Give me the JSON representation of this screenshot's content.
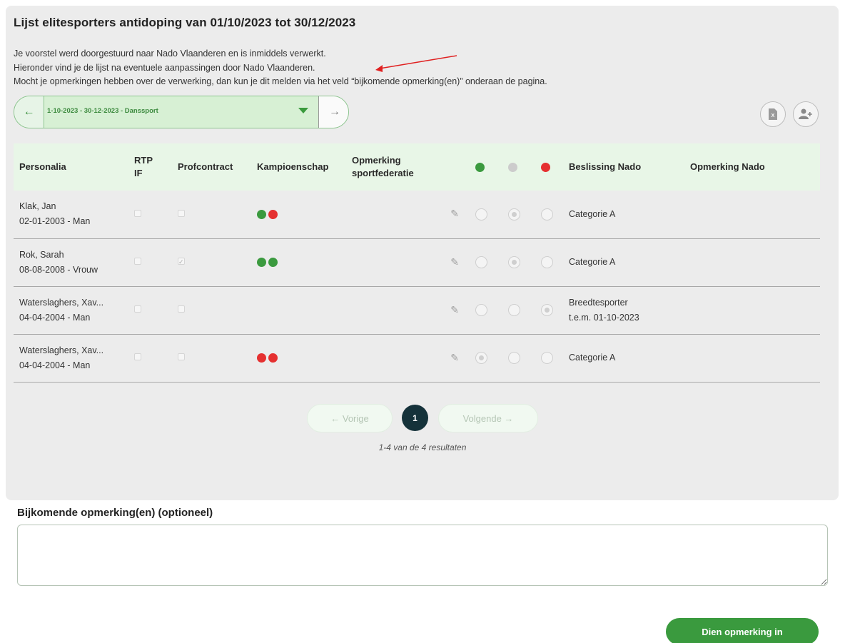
{
  "page": {
    "title": "Lijst elitesporters antidoping van 01/10/2023 tot 30/12/2023",
    "intro_lines": [
      "Je voorstel werd doorgestuurd naar Nado Vlaanderen en is inmiddels verwerkt.",
      "Hieronder vind je de lijst na eventuele aanpassingen door Nado Vlaanderen.",
      "Mocht je opmerkingen hebben over de verwerking, dan kun je dit melden via het veld “bijkomende opmerking(en)” onderaan de pagina."
    ]
  },
  "selector": {
    "value": "1-10-2023 - 30-12-2023 - Danssport",
    "prev_icon": "arrow-left-icon",
    "next_icon": "arrow-right-icon"
  },
  "toolbar": {
    "export_icon": "excel-export-icon",
    "add_user_icon": "add-user-icon"
  },
  "table": {
    "headers": {
      "personalia": "Personalia",
      "rtp_line1": "RTP",
      "rtp_line2": "IF",
      "profcontract": "Profcontract",
      "kampioenschap": "Kampioenschap",
      "opmerking_line1": "Opmerking",
      "opmerking_line2": "sportfederatie",
      "beslissing": "Beslissing Nado",
      "opmerking_nado": "Opmerking Nado"
    },
    "status_colors": {
      "green": "#3b9a3f",
      "grey": "#cccccc",
      "red": "#e53030"
    },
    "rows": [
      {
        "name": "Klak, Jan",
        "details": "02-01-2003 - Man",
        "rtp": false,
        "prof": false,
        "kampioenschap": [
          "green",
          "red"
        ],
        "selected_status": "grey",
        "beslissing": [
          "Categorie A"
        ],
        "opmerking_nado": ""
      },
      {
        "name": "Rok, Sarah",
        "details": "08-08-2008 - Vrouw",
        "rtp": false,
        "prof": true,
        "kampioenschap": [
          "green",
          "green"
        ],
        "selected_status": "grey",
        "beslissing": [
          "Categorie A"
        ],
        "opmerking_nado": ""
      },
      {
        "name": "Waterslaghers, Xav...",
        "details": "04-04-2004 - Man",
        "rtp": false,
        "prof": false,
        "kampioenschap": [],
        "selected_status": "red",
        "beslissing": [
          "Breedtesporter",
          "t.e.m. 01-10-2023"
        ],
        "opmerking_nado": ""
      },
      {
        "name": "Waterslaghers, Xav...",
        "details": "04-04-2004 - Man",
        "rtp": false,
        "prof": false,
        "kampioenschap": [
          "red",
          "red"
        ],
        "selected_status": "green",
        "beslissing": [
          "Categorie A"
        ],
        "opmerking_nado": ""
      }
    ]
  },
  "pagination": {
    "prev_label": "← Vorige",
    "current_page": "1",
    "next_label": "Volgende →",
    "results_text": "1-4 van de 4 resultaten"
  },
  "remarks": {
    "label": "Bijkomende opmerking(en) (optioneel)",
    "value": "",
    "submit_label": "Dien opmerking in"
  }
}
